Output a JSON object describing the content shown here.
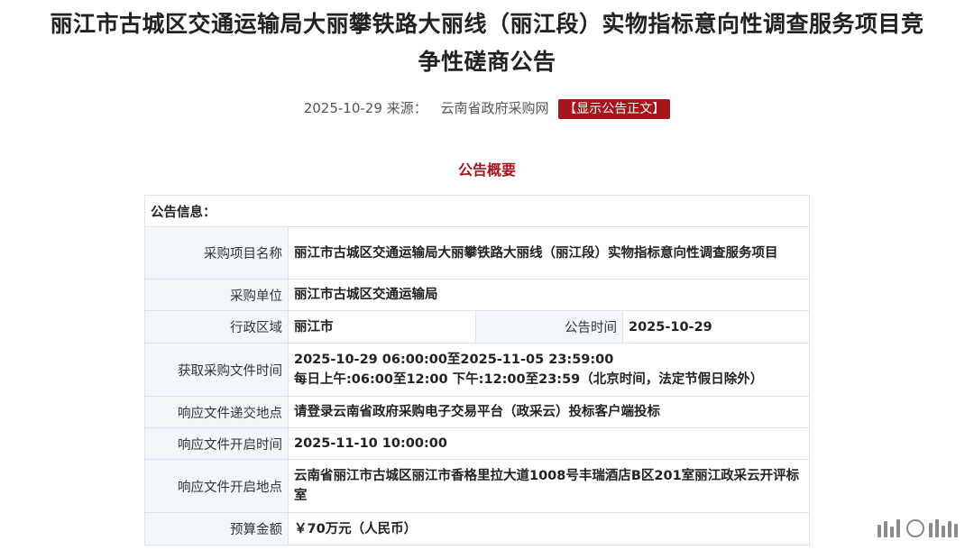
{
  "page": {
    "title_line1": "丽江市古城区交通运输局大丽攀铁路大丽线（丽江段）实物指标意向性调查服务项目竞",
    "title_line2": "争性磋商公告",
    "date": "2025-10-29",
    "source_label": "来源：",
    "source_name": "云南省政府采购网",
    "show_button": "【显示公告正文】",
    "summary_title": "公告概要"
  },
  "table": {
    "section_header": "公告信息：",
    "rows": {
      "project_name": {
        "label": "采购项目名称",
        "value": "丽江市古城区交通运输局大丽攀铁路大丽线（丽江段）实物指标意向性调查服务项目"
      },
      "purchaser": {
        "label": "采购单位",
        "value": "丽江市古城区交通运输局"
      },
      "region": {
        "label": "行政区域",
        "value": "丽江市"
      },
      "publish_time": {
        "label": "公告时间",
        "value": "2025-10-29"
      },
      "doc_time": {
        "label": "获取采购文件时间",
        "value1": "2025-10-29 06:00:00至2025-11-05 23:59:00",
        "value2": "每日上午:06:00至12:00  下午:12:00至23:59（北京时间，法定节假日除外）"
      },
      "submit_place": {
        "label": "响应文件递交地点",
        "value": "请登录云南省政府采购电子交易平台（政采云）投标客户端投标"
      },
      "open_time": {
        "label": "响应文件开启时间",
        "value": "2025-11-10 10:00:00"
      },
      "open_place": {
        "label": "响应文件开启地点",
        "value": "云南省丽江市古城区丽江市香格里拉大道1008号丰瑞酒店B区201室丽江政采云开评标室"
      },
      "budget": {
        "label": "预算金额",
        "value": "￥70万元（人民币）"
      }
    }
  }
}
